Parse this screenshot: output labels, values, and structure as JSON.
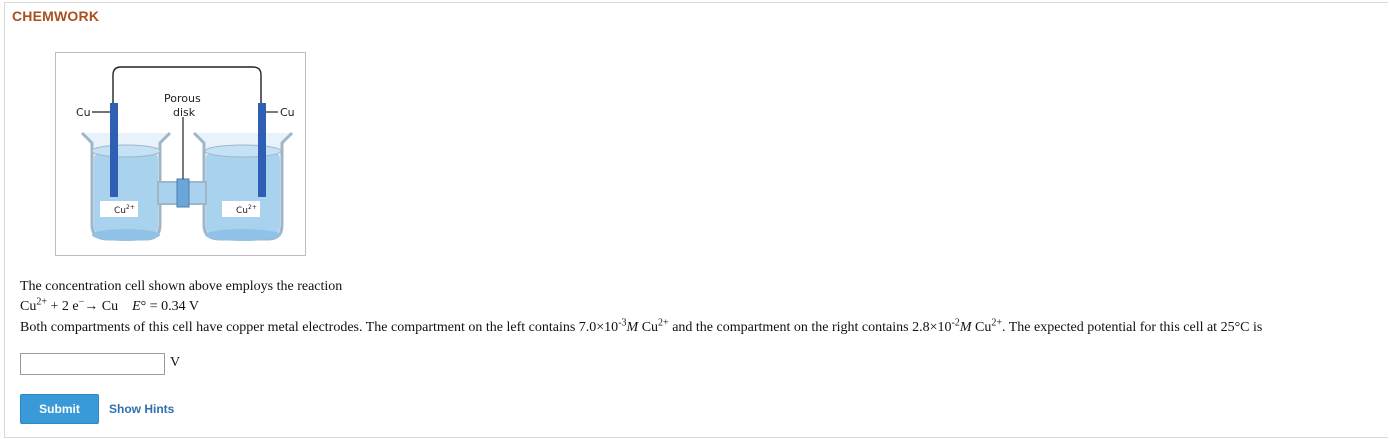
{
  "header": {
    "brand": "CHEMWORK"
  },
  "figure": {
    "left_electrode_label": "Cu",
    "right_electrode_label": "Cu",
    "disk_label_line1": "Porous",
    "disk_label_line2": "disk",
    "left_ion_base": "Cu",
    "left_ion_charge": "2+",
    "right_ion_base": "Cu",
    "right_ion_charge": "2+"
  },
  "problem": {
    "intro": "The concentration cell shown above employs the reaction",
    "reaction_base": "Cu",
    "reaction_charge": "2+",
    "reaction_mid": " + 2 e",
    "reaction_electron_charge": "−",
    "reaction_arrow": "→ Cu",
    "potential_symbol": "E",
    "potential_value": "° = 0.34 V",
    "line3_part1": "Both compartments of this cell have copper metal electrodes. The compartment on the left contains 7.0×10",
    "left_exponent": "-3",
    "molar_symbol": "M",
    "ion_base": " Cu",
    "ion_charge": "2+",
    "line3_part2": " and the compartment on the right contains 2.8×10",
    "right_exponent": "-2",
    "line3_part3": ". The expected potential for this cell at 25°C is"
  },
  "answer": {
    "value": "",
    "unit": "V"
  },
  "actions": {
    "submit_label": "Submit",
    "hints_label": "Show Hints"
  },
  "colors": {
    "brand": "#a9501e",
    "submit_bg": "#3a9ad9",
    "hints_link": "#2f6fb0",
    "solution": "#a9d2ef",
    "electrode": "#2f5fb3"
  }
}
